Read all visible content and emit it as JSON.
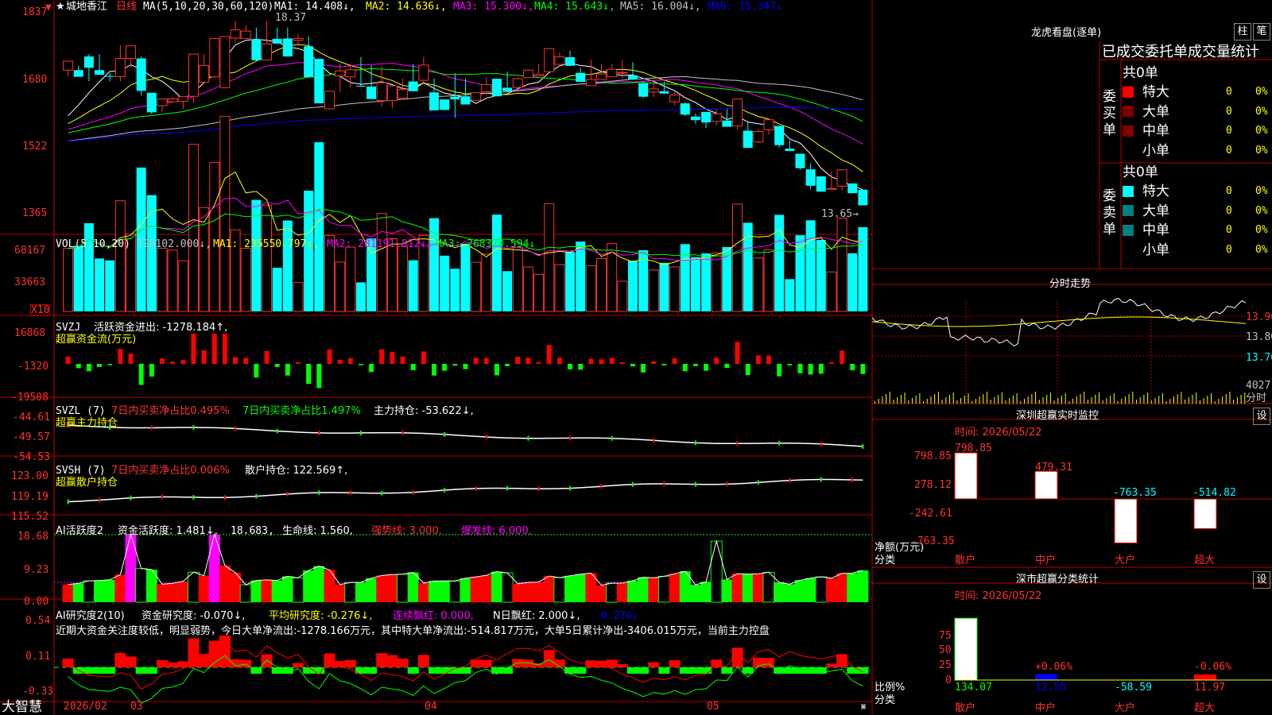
{
  "app": {
    "logo": "大智慧"
  },
  "title_bar": {
    "star": "★",
    "stock_name": "城地香江",
    "period": "日线",
    "ma_prefix": "MA(5,10,20,30,60,120)",
    "ma": [
      {
        "label": "MA1: 14.408↓,",
        "color": "#ffffff"
      },
      {
        "label": "MA2: 14.636↓,",
        "color": "#ffff00"
      },
      {
        "label": "MA3: 15.300↓,",
        "color": "#ff00ff"
      },
      {
        "label": "MA4: 15.643↓,",
        "color": "#00ff00"
      },
      {
        "label": "MA5: 16.004↓,",
        "color": "#c0c0c0"
      },
      {
        "label": "MA6: 15.347↓",
        "color": "#0000ff"
      }
    ]
  },
  "chart_data": [
    {
      "type": "candlestick",
      "title": "城地香江 日线",
      "y_ticks": [
        "1837",
        "1680",
        "1522",
        "1365"
      ],
      "ylim": [
        13.15,
        18.6
      ],
      "high_label": "18.37",
      "low_label": "13.65→",
      "x_labels": [
        "2026/02",
        "03",
        "04",
        "05"
      ],
      "ohlc": [
        [
          17.11,
          17.34,
          16.95,
          17.34
        ],
        [
          17.11,
          17.22,
          16.94,
          16.94
        ],
        [
          17.46,
          17.52,
          16.82,
          17.17
        ],
        [
          17.11,
          17.52,
          16.99,
          16.99
        ],
        [
          16.96,
          17.03,
          16.82,
          16.94
        ],
        [
          16.94,
          17.75,
          16.82,
          17.41
        ],
        [
          17.41,
          17.75,
          17.17,
          17.73
        ],
        [
          17.41,
          17.46,
          16.46,
          16.58
        ],
        [
          16.53,
          16.53,
          15.98,
          16.03
        ],
        [
          16.2,
          16.37,
          16.03,
          16.37
        ],
        [
          16.3,
          16.43,
          16.37,
          16.37
        ],
        [
          16.31,
          16.37,
          16.12,
          16.43
        ],
        [
          16.44,
          17.52,
          16.28,
          17.52
        ],
        [
          16.8,
          17.52,
          16.8,
          17.23
        ],
        [
          16.94,
          17.65,
          17.18,
          17.92
        ],
        [
          16.66,
          17.6,
          17.47,
          17.97
        ],
        [
          17.93,
          18.37,
          17.81,
          18.14
        ],
        [
          17.92,
          18.26,
          18.02,
          18.11
        ],
        [
          17.9,
          18.2,
          17.36,
          17.36
        ],
        [
          17.37,
          18.37,
          17.38,
          17.78
        ],
        [
          17.91,
          18.2,
          17.79,
          17.79
        ],
        [
          17.92,
          18.2,
          17.46,
          17.46
        ],
        [
          17.87,
          18.03,
          17.72,
          17.92
        ],
        [
          17.72,
          17.98,
          16.95,
          16.93
        ],
        [
          17.4,
          17.26,
          16.32,
          16.26
        ],
        [
          16.12,
          16.55,
          16.12,
          16.57
        ],
        [
          16.96,
          17.27,
          16.55,
          17.09
        ],
        [
          16.94,
          17.28,
          16.67,
          17.12
        ],
        [
          16.71,
          17.45,
          16.7,
          16.7
        ],
        [
          16.69,
          17.24,
          16.38,
          16.37
        ],
        [
          16.33,
          17.21,
          16.17,
          16.79
        ],
        [
          16.33,
          16.68,
          16.13,
          16.71
        ],
        [
          16.39,
          16.9,
          16.36,
          16.62
        ],
        [
          16.82,
          17.27,
          16.67,
          16.57
        ],
        [
          16.85,
          17.45,
          16.79,
          17.24
        ],
        [
          16.54,
          16.89,
          16.08,
          16.08
        ],
        [
          16.36,
          16.35,
          16.09,
          16.09
        ],
        [
          16.43,
          17.03,
          15.89,
          16.36
        ],
        [
          16.44,
          16.89,
          16.44,
          16.23
        ],
        [
          16.34,
          16.53,
          16.31,
          16.53
        ],
        [
          16.56,
          16.92,
          16.47,
          16.74
        ],
        [
          16.89,
          16.89,
          16.44,
          16.44
        ],
        [
          16.66,
          17.07,
          16.67,
          16.57
        ],
        [
          16.67,
          16.92,
          16.75,
          16.89
        ],
        [
          16.92,
          17.08,
          16.97,
          17.11
        ],
        [
          16.96,
          17.26,
          17.0,
          17.0
        ],
        [
          17.07,
          17.66,
          17.14,
          17.66
        ],
        [
          17.26,
          17.56,
          17.38,
          17.45
        ],
        [
          17.44,
          17.61,
          17.36,
          17.22
        ],
        [
          17.04,
          17.17,
          16.97,
          16.81
        ],
        [
          16.71,
          17.38,
          16.87,
          16.87
        ],
        [
          16.87,
          17.26,
          16.9,
          17.01
        ],
        [
          16.94,
          17.26,
          16.95,
          17.13
        ],
        [
          17.05,
          17.36,
          16.91,
          17.05
        ],
        [
          16.97,
          17.31,
          16.87,
          16.87
        ],
        [
          16.77,
          16.81,
          16.39,
          16.43
        ],
        [
          16.55,
          16.82,
          16.42,
          16.63
        ],
        [
          16.57,
          16.82,
          16.51,
          16.51
        ],
        [
          16.3,
          16.55,
          16.21,
          16.47
        ],
        [
          16.26,
          16.28,
          15.93,
          15.97
        ],
        [
          15.92,
          16.0,
          15.74,
          15.83
        ],
        [
          16.04,
          16.04,
          15.63,
          15.77
        ],
        [
          15.8,
          16.11,
          15.7,
          15.99
        ],
        [
          15.82,
          16.11,
          15.66,
          15.66
        ],
        [
          15.68,
          16.37,
          15.58,
          16.37
        ],
        [
          15.56,
          15.77,
          15.12,
          15.12
        ],
        [
          15.27,
          15.6,
          15.24,
          15.54
        ],
        [
          15.58,
          15.84,
          15.46,
          15.84
        ],
        [
          15.68,
          15.69,
          15.13,
          15.19
        ],
        [
          15.1,
          15.31,
          15.04,
          15.04
        ],
        [
          14.97,
          14.97,
          14.56,
          14.6
        ],
        [
          14.57,
          14.73,
          14.06,
          14.15
        ],
        [
          14.39,
          14.39,
          14.0,
          14.0
        ],
        [
          14.06,
          14.52,
          14.06,
          14.08
        ],
        [
          14.14,
          14.56,
          14.03,
          14.56
        ],
        [
          14.21,
          14.21,
          13.96,
          13.96
        ],
        [
          14.05,
          14.05,
          13.65,
          13.65
        ]
      ]
    },
    {
      "type": "bar",
      "title": "VOL(5,10,20)",
      "y_ticks": [
        "68167",
        "33663",
        "X10"
      ],
      "legend": [
        {
          "label": "128102.000↓,",
          "color": "#c0c0c0"
        },
        {
          "label": "MA1: 235550.797↓,",
          "color": "#ffff00"
        },
        {
          "label": "MA2: 281191.812↓,",
          "color": "#ff00ff"
        },
        {
          "label": "MA3: 268370.594↓",
          "color": "#00ff00"
        }
      ]
    },
    {
      "type": "bar",
      "title": "SVZJ",
      "legend_text": "活跃资金进出: -1278.184↑,",
      "sub_label": "超赢资金流(万元)",
      "y_ticks": [
        "16868",
        "-1320",
        "-19508"
      ]
    },
    {
      "type": "line",
      "title": "SVZL (7)",
      "legend": [
        {
          "label": "7日内买卖净占比0.495%",
          "color": "#ff3232"
        },
        {
          "label": "7日内买卖净占比1.497%",
          "color": "#00ff00"
        },
        {
          "label": "主力持仓: -53.622↓,",
          "color": "#ffffff"
        }
      ],
      "sub_label": "超赢主力持仓",
      "y_ticks": [
        "-44.61",
        "-49.57",
        "-54.53"
      ]
    },
    {
      "type": "line",
      "title": "SVSH (7)",
      "legend": [
        {
          "label": "7日内买卖净占比0.006%",
          "color": "#ff3232"
        },
        {
          "label": "散户持仓: 122.569↑,",
          "color": "#ffffff"
        }
      ],
      "sub_label": "超赢散户持仓",
      "y_ticks": [
        "123.00",
        "119.19",
        "115.52"
      ]
    },
    {
      "type": "bar",
      "title": "AI活跃度2",
      "legend": [
        {
          "label": "资金活跃度: 1.481↓,",
          "color": "#ffffff"
        },
        {
          "label": "18.683,",
          "color": "#ffffff"
        },
        {
          "label": "生命线: 1.560,",
          "color": "#ffffff"
        },
        {
          "label": "强势线: 3.000,",
          "color": "#ff3232"
        },
        {
          "label": "爆发线: 6.000,",
          "color": "#ff00ff"
        }
      ],
      "y_ticks": [
        "18.68",
        "9.23",
        "0.00"
      ]
    },
    {
      "type": "bar",
      "title": "AI研究度2(10)",
      "legend": [
        {
          "label": "资金研究度: -0.070↓,",
          "color": "#ffffff"
        },
        {
          "label": "平均研究度: -0.276↓,",
          "color": "#ffff00"
        },
        {
          "label": "连续飘红: 0.000,",
          "color": "#ff00ff"
        },
        {
          "label": "N日飘红: 2.000↓,",
          "color": "#ffffff"
        },
        {
          "label": "-0.276↓",
          "color": "#0000ff"
        }
      ],
      "comment": "近期大资金关注度较低，明显弱势，今日大单净流出:-1278.166万元，其中特大单净流出:-514.817万元，大单5日累计净出-3406.015万元，当前主力控盘",
      "y_ticks": [
        "0.54",
        "0.11",
        "-0.33"
      ]
    },
    {
      "type": "bar",
      "title": "深圳超赢实时监控",
      "time_label": "时间: 2026/05/22",
      "y_label": "净额(万元)",
      "x_label": "分类",
      "y_ticks": [
        "798.85",
        "278.12",
        "-242.61",
        "-763.35"
      ],
      "categories": [
        "散户",
        "中户",
        "大户",
        "超大"
      ],
      "values": [
        798.85,
        479.31,
        -763.35,
        -514.82
      ],
      "value_labels": [
        "798.85",
        "479.31",
        "-763.35",
        "-514.82"
      ]
    },
    {
      "type": "bar",
      "title": "深市超赢分类统计",
      "time_label": "时间: 2026/05/22",
      "y_label": "比例%",
      "x_label": "分类",
      "y_ticks": [
        "75",
        "50",
        "25",
        "0"
      ],
      "categories": [
        "散户",
        "中户",
        "大户",
        "超大"
      ],
      "values": [
        134.07,
        12.55,
        -58.59,
        11.97
      ],
      "value_labels": [
        "134.07",
        "12.55",
        "-58.59",
        "11.97"
      ],
      "pct_labels": [
        "",
        "+0.06%",
        "",
        "-0.06%"
      ]
    },
    {
      "type": "line",
      "title": "分时走势",
      "y_ticks": [
        "13.90",
        "13.80",
        "13.70"
      ],
      "vol_label": "4027",
      "vol_unit": "分时"
    }
  ],
  "longhu": {
    "title": "龙虎看盘(逐单)",
    "tab_zhu": "柱",
    "tab_bi": "笔",
    "header": "已成交委托单成交量统计",
    "buy_label": "委买单",
    "sell_label": "委卖单",
    "buy_total": "共0单",
    "sell_total": "共0单",
    "rows": [
      {
        "label": "特大",
        "count": "0",
        "pct": "0%"
      },
      {
        "label": "大单",
        "count": "0",
        "pct": "0%"
      },
      {
        "label": "中单",
        "count": "0",
        "pct": "0%"
      },
      {
        "label": "小单",
        "count": "0",
        "pct": "0%"
      }
    ],
    "set_btn": "设"
  },
  "colors": {
    "up": "#ff3232",
    "down": "#00ffff",
    "grid": "#c00000",
    "text": "#c0c0c0"
  }
}
